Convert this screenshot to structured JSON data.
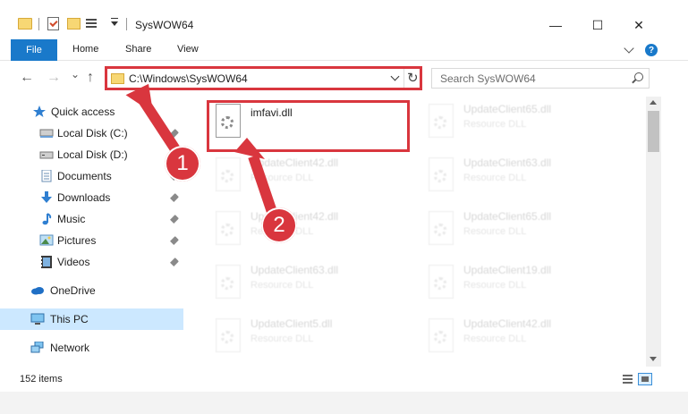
{
  "window": {
    "title": "SysWOW64",
    "minimize_label": "—",
    "maximize_label": "☐",
    "close_label": "✕"
  },
  "ribbon": {
    "tabs": [
      "File",
      "Home",
      "Share",
      "View"
    ],
    "help_label": "?"
  },
  "navbar": {
    "back_icon": "←",
    "forward_icon": "→",
    "recent_icon": "⌄",
    "up_icon": "↑",
    "address": "C:\\Windows\\SysWOW64",
    "refresh_icon": "↻",
    "search_placeholder": "Search SysWOW64"
  },
  "sidebar": {
    "items": [
      {
        "label": "Quick access",
        "icon": "star-icon",
        "pinned": false
      },
      {
        "label": "Local Disk (C:)",
        "icon": "drive-icon",
        "pinned": true
      },
      {
        "label": "Local Disk (D:)",
        "icon": "drive-icon",
        "pinned": false
      },
      {
        "label": "Documents",
        "icon": "documents-icon",
        "pinned": true
      },
      {
        "label": "Downloads",
        "icon": "downloads-icon",
        "pinned": true
      },
      {
        "label": "Music",
        "icon": "music-icon",
        "pinned": true
      },
      {
        "label": "Pictures",
        "icon": "pictures-icon",
        "pinned": true
      },
      {
        "label": "Videos",
        "icon": "videos-icon",
        "pinned": true
      },
      {
        "label": "OneDrive",
        "icon": "onedrive-icon",
        "pinned": false
      },
      {
        "label": "This PC",
        "icon": "this-pc-icon",
        "pinned": false,
        "selected": true
      },
      {
        "label": "Network",
        "icon": "network-icon",
        "pinned": false
      }
    ]
  },
  "files": [
    {
      "name": "imfavi.dll",
      "type": "",
      "highlighted": true
    },
    {
      "name": "UpdateClient65.dll",
      "type": "Resource DLL"
    },
    {
      "name": "UpdateClient42.dll",
      "type": "Resource DLL"
    },
    {
      "name": "UpdateClient63.dll",
      "type": "Resource DLL"
    },
    {
      "name": "UpdateClient42.dll",
      "type": "Resource DLL"
    },
    {
      "name": "UpdateClient65.dll",
      "type": "Resource DLL"
    },
    {
      "name": "UpdateClient63.dll",
      "type": "Resource DLL"
    },
    {
      "name": "UpdateClient19.dll",
      "type": "Resource DLL"
    },
    {
      "name": "UpdateClient5.dll",
      "type": "Resource DLL"
    },
    {
      "name": "UpdateClient42.dll",
      "type": "Resource DLL"
    }
  ],
  "status": {
    "item_count": "152 items"
  },
  "annotations": {
    "step1": "1",
    "step2": "2",
    "color": "#d9363e"
  }
}
